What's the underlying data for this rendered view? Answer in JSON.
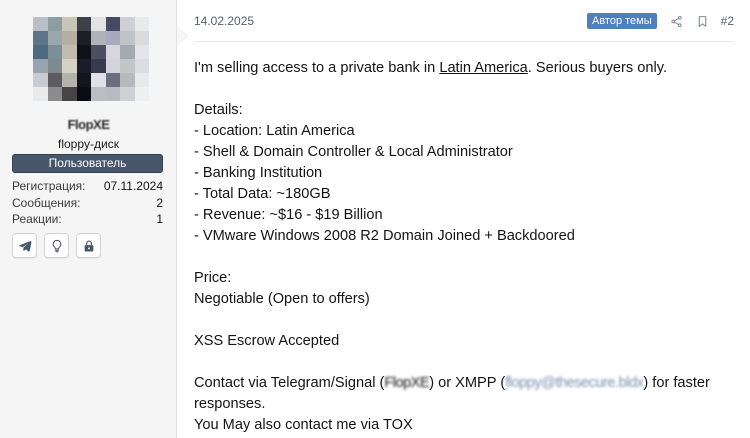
{
  "user": {
    "name": "FlopXE",
    "title": "floppy-диск",
    "role": "Пользователь",
    "stats": [
      {
        "label": "Регистрация:",
        "value": "07.11.2024"
      },
      {
        "label": "Сообщения:",
        "value": "2"
      },
      {
        "label": "Реакции:",
        "value": "1"
      }
    ],
    "icons": [
      "telegram-icon",
      "lightbulb-icon",
      "lock-icon"
    ],
    "avatar_colors": [
      "#b9bfc4",
      "#8e9da1",
      "#c8c6b8",
      "#3e3f47",
      "#e2e1e4",
      "#47495f",
      "#ced0d4",
      "#e9eaec",
      "#5c7487",
      "#9aa6aa",
      "#b4b0a1",
      "#1c1d25",
      "#b1b2b9",
      "#a8a9bc",
      "#bfc2c6",
      "#d9dbdf",
      "#4c6a80",
      "#7a8f96",
      "#c0bcb0",
      "#0f1018",
      "#4d4e60",
      "#d6d6dc",
      "#a6aab0",
      "#e2e4e7",
      "#96a5b0",
      "#7d8a8e",
      "#d6d1c4",
      "#1a1c2b",
      "#383a4d",
      "#d3d3d9",
      "#c3c5c9",
      "#dcdde0",
      "#c7ccd0",
      "#5c5c60",
      "#b4b3a9",
      "#13141c",
      "#e0e0e5",
      "#6c6d7e",
      "#b7b9bd",
      "#e8e9eb",
      "#e9eaeb",
      "#8c8c8c",
      "#454545",
      "#0b0c12",
      "#bcbcc4",
      "#b9bac1",
      "#cfd1d4",
      "#eeeff0"
    ]
  },
  "post": {
    "date": "14.02.2025",
    "author_badge": "Автор темы",
    "number": "#2",
    "intro_before": "I'm selling access to a private bank in ",
    "intro_link": "Latin America",
    "intro_after": ". Serious buyers only.",
    "details_heading": "Details:",
    "details": [
      "- Location: Latin America",
      "- Shell & Domain Controller & Local Administrator",
      "- Banking Institution",
      "- Total Data: ~180GB",
      "- Revenue: ~$16 - $19 Billion",
      "- VMware Windows 2008 R2 Domain Joined + Backdoored"
    ],
    "price_heading": "Price:",
    "price_value": "Negotiable (Open to offers)",
    "escrow": "XSS Escrow Accepted",
    "contact_prefix": "Contact via Telegram/Signal (",
    "contact_telegram": "FlopXE",
    "contact_middle": ") or XMPP (",
    "contact_xmpp": "floppy@thesecure.bldx",
    "contact_suffix": ") for faster",
    "contact_line2": "responses.",
    "tox_line": "You May also contact me via TOX"
  }
}
